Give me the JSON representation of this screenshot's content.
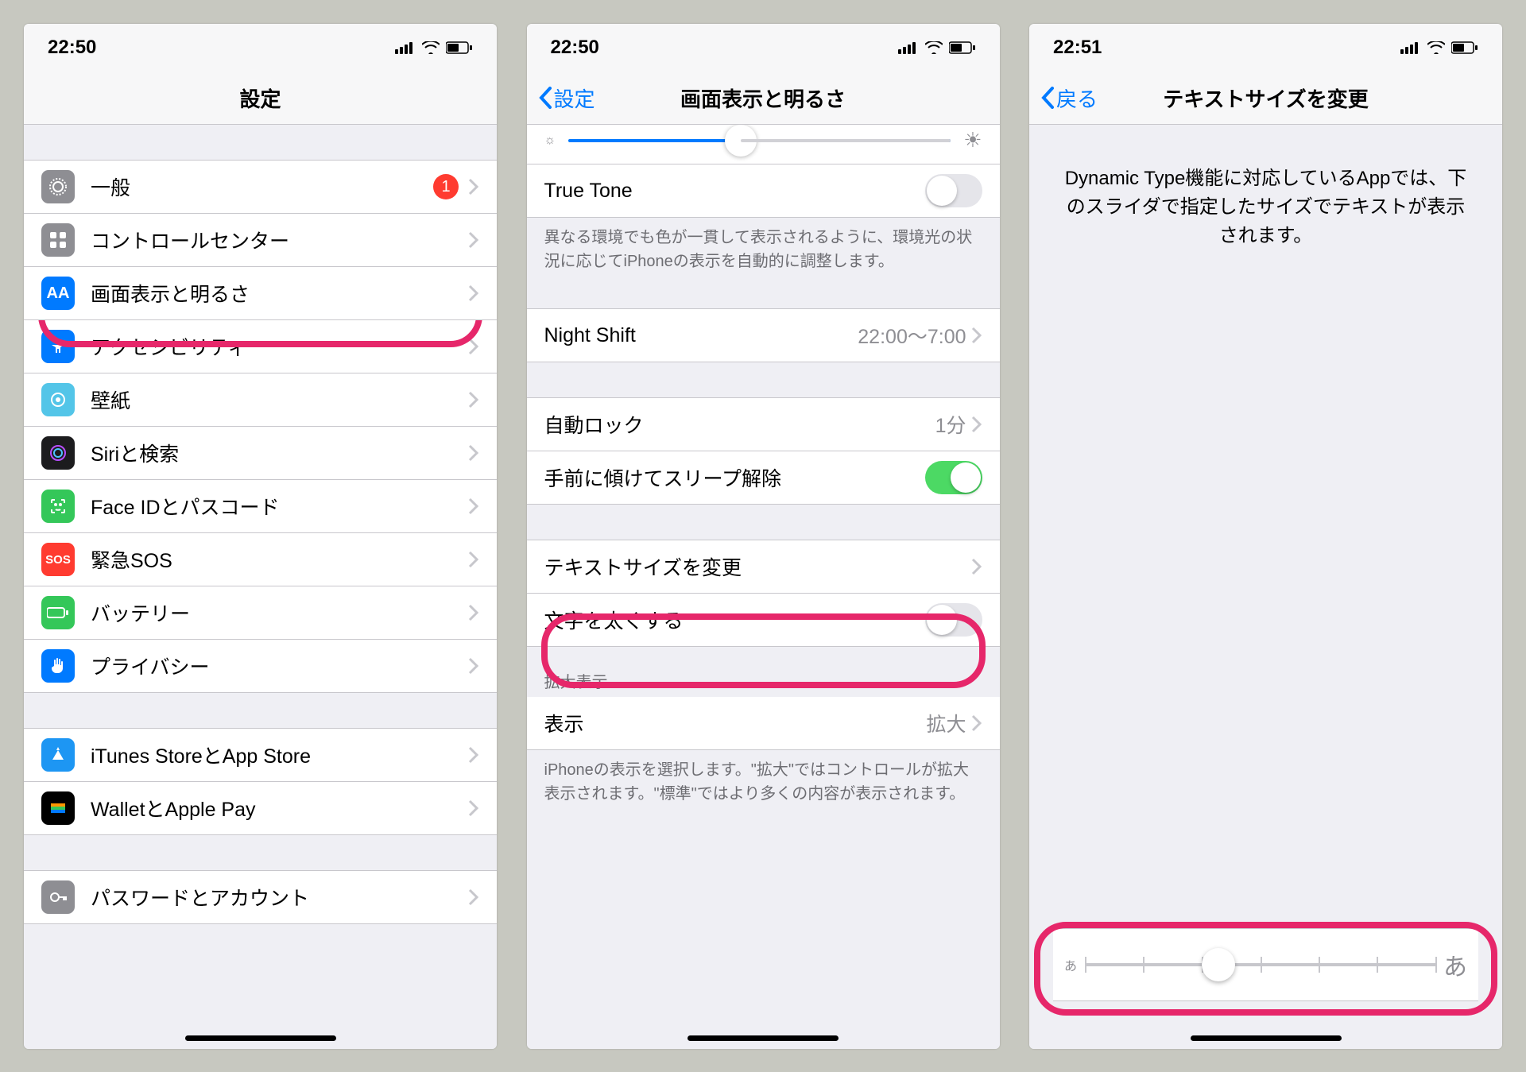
{
  "status": {
    "time1": "22:50",
    "time2": "22:50",
    "time3": "22:51"
  },
  "screen1": {
    "title": "設定",
    "rows": {
      "general": "一般",
      "badge": "1",
      "cc": "コントロールセンター",
      "display": "画面表示と明るさ",
      "accessibility": "アクセシビリティ",
      "wallpaper": "壁紙",
      "siri": "Siriと検索",
      "faceid": "Face IDとパスコード",
      "sos": "緊急SOS",
      "battery": "バッテリー",
      "privacy": "プライバシー",
      "itunes": "iTunes StoreとApp Store",
      "wallet": "WalletとApple Pay",
      "passwords": "パスワードとアカウント"
    }
  },
  "screen2": {
    "back": "設定",
    "title": "画面表示と明るさ",
    "truetone": "True Tone",
    "truetone_desc": "異なる環境でも色が一貫して表示されるように、環境光の状況に応じてiPhoneの表示を自動的に調整します。",
    "nightshift": "Night Shift",
    "nightshift_detail": "22:00～7:00",
    "autolock": "自動ロック",
    "autolock_detail": "1分",
    "raise": "手前に傾けてスリープ解除",
    "textsize": "テキストサイズを変更",
    "bold": "文字を太くする",
    "zoom_header": "拡大表示",
    "zoom_row": "表示",
    "zoom_detail": "拡大",
    "zoom_desc": "iPhoneの表示を選択します。\"拡大\"ではコントロールが拡大表示されます。\"標準\"ではより多くの内容が表示されます。"
  },
  "screen3": {
    "back": "戻る",
    "title": "テキストサイズを変更",
    "explain": "Dynamic Type機能に対応しているAppでは、下のスライダで指定したサイズでテキストが表示されます。",
    "small": "あ",
    "large": "あ"
  }
}
